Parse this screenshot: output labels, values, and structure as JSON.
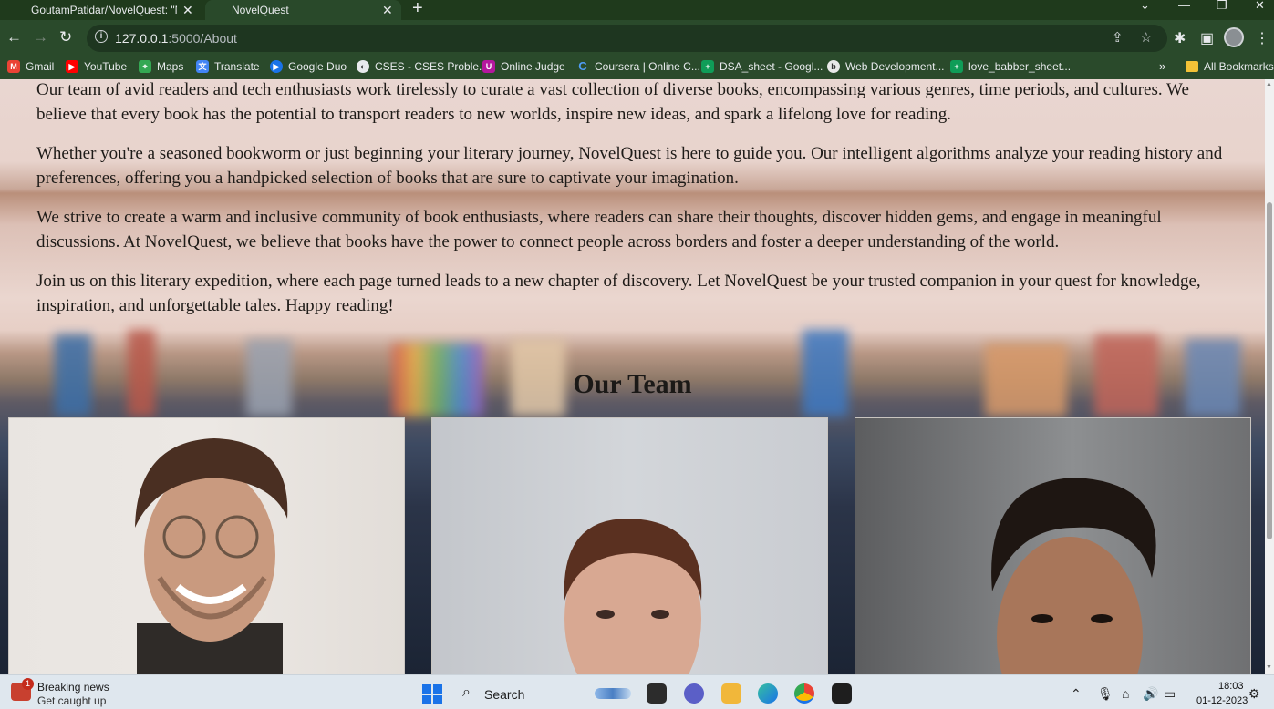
{
  "browser": {
    "tabs": [
      {
        "title": "GoutamPatidar/NovelQuest: \"N",
        "active": false
      },
      {
        "title": "NovelQuest",
        "active": true
      }
    ],
    "url_host": "127.0.0.1",
    "url_path": ":5000/About",
    "bookmarks": [
      {
        "label": "Gmail",
        "icon": "gmail-icon",
        "color": "#ea4335"
      },
      {
        "label": "YouTube",
        "icon": "youtube-icon",
        "color": "#ff0000"
      },
      {
        "label": "Maps",
        "icon": "maps-icon",
        "color": "#34a853"
      },
      {
        "label": "Translate",
        "icon": "translate-icon",
        "color": "#4285f4"
      },
      {
        "label": "Google Duo",
        "icon": "duo-icon",
        "color": "#1a73e8"
      },
      {
        "label": "CSES - CSES Proble...",
        "icon": "cses-icon",
        "color": "#e8eaed"
      },
      {
        "label": "Online Judge",
        "icon": "uva-icon",
        "color": "#b5179e"
      },
      {
        "label": "Coursera | Online C...",
        "icon": "coursera-icon",
        "color": "#2a73cc"
      },
      {
        "label": "DSA_sheet - Googl...",
        "icon": "sheets-icon",
        "color": "#0f9d58"
      },
      {
        "label": "Web Development...",
        "icon": "webdev-icon",
        "color": "#e9e9e9"
      },
      {
        "label": "love_babber_sheet...",
        "icon": "sheets-icon",
        "color": "#0f9d58"
      }
    ],
    "all_bookmarks_label": "All Bookmarks"
  },
  "page": {
    "paragraphs": [
      "Our team of avid readers and tech enthusiasts work tirelessly to curate a vast collection of diverse books, encompassing various genres, time periods, and cultures. We believe that every book has the potential to transport readers to new worlds, inspire new ideas, and spark a lifelong love for reading.",
      "Whether you're a seasoned bookworm or just beginning your literary journey, NovelQuest is here to guide you. Our intelligent algorithms analyze your reading history and preferences, offering you a handpicked selection of books that are sure to captivate your imagination.",
      "We strive to create a warm and inclusive community of book enthusiasts, where readers can share their thoughts, discover hidden gems, and engage in meaningful discussions. At NovelQuest, we believe that books have the power to connect people across borders and foster a deeper understanding of the world.",
      "Join us on this literary expedition, where each page turned leads to a new chapter of discovery. Let NovelQuest be your trusted companion in your quest for knowledge, inspiration, and unforgettable tales. Happy reading!"
    ],
    "team_heading": "Our Team"
  },
  "taskbar": {
    "news_title": "Breaking news",
    "news_subtitle": "Get caught up",
    "news_badge": "1",
    "search_label": "Search",
    "time": "18:03",
    "date": "01-12-2023"
  },
  "colors": {
    "browser_frame": "#2a4a2b",
    "page_text": "#1e1b18",
    "windows_accent": "#1a73e8"
  }
}
